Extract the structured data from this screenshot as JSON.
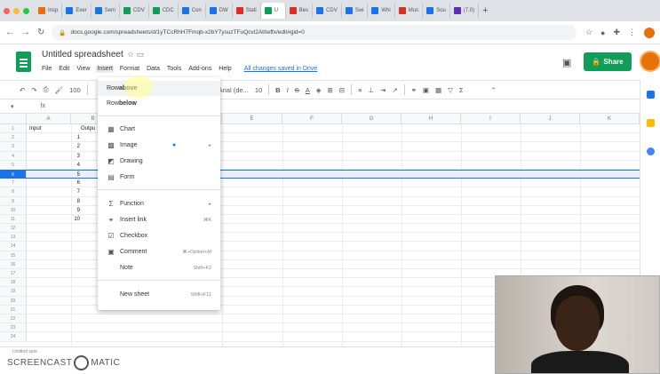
{
  "browser": {
    "tabs": [
      {
        "label": "Insp",
        "color": "#e8710a"
      },
      {
        "label": "Exer",
        "color": "#1a73e8"
      },
      {
        "label": "Sem",
        "color": "#1a73e8"
      },
      {
        "label": "CDV",
        "color": "#0f9d58"
      },
      {
        "label": "CDC",
        "color": "#0f9d58"
      },
      {
        "label": "Con",
        "color": "#1a73e8"
      },
      {
        "label": "DW",
        "color": "#1a73e8"
      },
      {
        "label": "Stati",
        "color": "#d93025"
      },
      {
        "label": "U",
        "color": "#0f9d58",
        "active": true
      },
      {
        "label": "Bes",
        "color": "#d93025"
      },
      {
        "label": "CDV",
        "color": "#1a73e8"
      },
      {
        "label": "Swi",
        "color": "#1a73e8"
      },
      {
        "label": "Whi",
        "color": "#1a73e8"
      },
      {
        "label": "Mus",
        "color": "#d93025"
      },
      {
        "label": "Sou",
        "color": "#1a73e8"
      },
      {
        "label": "(7,0)",
        "color": "#5f2eb8"
      }
    ],
    "url": "docs.google.com/spreadsheets/d/1yTCcRhH7Fmqb-x2bY7ysuzTFuQcvl2AtIIeffx/edit#gid=0"
  },
  "sheets": {
    "doc_title": "Untitled spreadsheet",
    "menu": [
      "File",
      "Edit",
      "View",
      "Insert",
      "Format",
      "Data",
      "Tools",
      "Add-ons",
      "Help"
    ],
    "saved_status": "All changes saved in Drive",
    "share_label": "Share",
    "toolbar": {
      "zoom": "100",
      "font": "Arial (de...",
      "font_size": "10"
    },
    "formula_cell": "",
    "columns": [
      "A",
      "B",
      "C",
      "D",
      "E",
      "F",
      "G",
      "H",
      "I",
      "J",
      "K"
    ],
    "header_row": {
      "a": "Input",
      "b": "Outpu"
    },
    "values": [
      "1",
      "2",
      "3",
      "4",
      "5",
      "6",
      "7",
      "8",
      "9",
      "10"
    ],
    "selected_row": 5
  },
  "insert_menu": {
    "row_above": {
      "prefix": "Row ",
      "bold": "above"
    },
    "row_below": {
      "prefix": "Row ",
      "bold": "below"
    },
    "chart": "Chart",
    "image": "Image",
    "drawing": "Drawing",
    "form": "Form",
    "function": "Function",
    "insert_link": "Insert link",
    "insert_link_shortcut": "⌘K",
    "checkbox": "Checkbox",
    "comment": "Comment",
    "comment_shortcut": "⌘+Option+M",
    "note": "Note",
    "note_shortcut": "Shift+F2",
    "new_sheet": "New sheet",
    "new_sheet_shortcut": "Shift+F11"
  },
  "watermark": {
    "left": "SCREENCAST",
    "right": "MATIC",
    "small": "Untitled spre"
  }
}
